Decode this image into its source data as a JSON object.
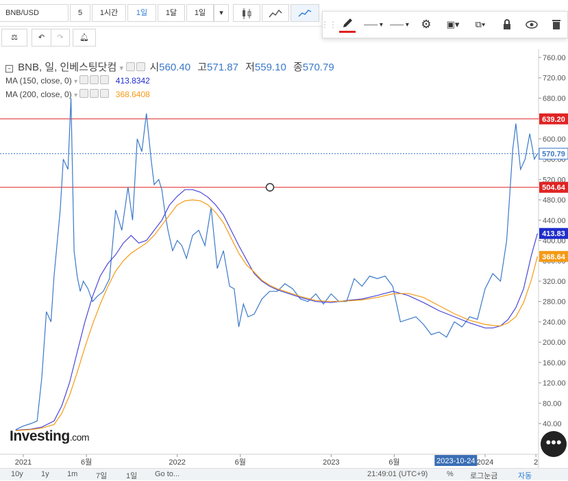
{
  "toolbar": {
    "symbol": "BNB/USD",
    "interval_value": "5",
    "btn_1h": "1시간",
    "btn_1d": "1일",
    "btn_1m": "1달",
    "btn_1d2": "1일"
  },
  "drawing_toolbar": {
    "pencil_color": "#e02020"
  },
  "legend": {
    "title": "BNB, 일, 인베스팅닷컴",
    "open_label": "시",
    "open_value": "560.40",
    "high_label": "고",
    "high_value": "571.87",
    "low_label": "저",
    "low_value": "559.10",
    "close_label": "종",
    "close_value": "570.79",
    "ma150_label": "MA (150, close, 0)",
    "ma150_value": "413.8342",
    "ma200_label": "MA (200, close, 0)",
    "ma200_value": "368.6408"
  },
  "watermark": {
    "brand": "Investing",
    "suffix": ".com"
  },
  "bottom": {
    "range_10y": "10y",
    "range_1y": "1y",
    "range_1m": "1m",
    "range_7d": "7일",
    "range_1d": "1일",
    "goto": "Go to...",
    "time": "21:49:01 (UTC+9)",
    "pct": "%",
    "log": "로그눈금",
    "auto": "자동"
  },
  "colors": {
    "price": "#3a78c9",
    "ma150": "#4a46d8",
    "ma200": "#f59a16",
    "hline": "#e02424",
    "ma150_tag": "#1f2dcc",
    "ma200_tag": "#f59a16",
    "price_tag": "#3a78c9"
  },
  "chart_data": {
    "type": "line",
    "title": "BNB, 일, 인베스팅닷컴",
    "ylim": [
      0,
      770
    ],
    "y_ticks": [
      40,
      80,
      120,
      160,
      200,
      240,
      280,
      320,
      360,
      400,
      440,
      480,
      520,
      560,
      600,
      640,
      680,
      720,
      760
    ],
    "x_tick_labels": [
      {
        "t": 2021.0,
        "label": "2021"
      },
      {
        "t": 2021.41,
        "label": "6월"
      },
      {
        "t": 2022.0,
        "label": "2022"
      },
      {
        "t": 2022.41,
        "label": "6월"
      },
      {
        "t": 2023.0,
        "label": "2023"
      },
      {
        "t": 2023.41,
        "label": "6월"
      },
      {
        "t": 2024.0,
        "label": "2024"
      },
      {
        "t": 2024.33,
        "label": "2"
      }
    ],
    "crosshair_x_label": "2023-10-24",
    "horizontal_lines": [
      639.2,
      504.64
    ],
    "price_tags": {
      "close": 570.79,
      "ma150": 413.83,
      "ma200": 368.64,
      "hline_top": 639.2,
      "hline_bottom": 504.64
    },
    "series": [
      {
        "name": "BNB",
        "x": [
          2020.95,
          2021.0,
          2021.05,
          2021.09,
          2021.12,
          2021.15,
          2021.18,
          2021.2,
          2021.24,
          2021.26,
          2021.29,
          2021.31,
          2021.33,
          2021.35,
          2021.37,
          2021.39,
          2021.42,
          2021.45,
          2021.48,
          2021.52,
          2021.56,
          2021.6,
          2021.64,
          2021.68,
          2021.71,
          2021.74,
          2021.77,
          2021.8,
          2021.83,
          2021.85,
          2021.88,
          2021.9,
          2021.92,
          2021.94,
          2021.97,
          2022.0,
          2022.03,
          2022.06,
          2022.1,
          2022.14,
          2022.18,
          2022.22,
          2022.26,
          2022.3,
          2022.34,
          2022.37,
          2022.4,
          2022.43,
          2022.46,
          2022.5,
          2022.55,
          2022.6,
          2022.65,
          2022.7,
          2022.75,
          2022.8,
          2022.85,
          2022.9,
          2022.95,
          2023.0,
          2023.05,
          2023.1,
          2023.15,
          2023.2,
          2023.25,
          2023.3,
          2023.35,
          2023.4,
          2023.45,
          2023.5,
          2023.55,
          2023.6,
          2023.65,
          2023.7,
          2023.75,
          2023.8,
          2023.85,
          2023.9,
          2023.95,
          2024.0,
          2024.05,
          2024.1,
          2024.14,
          2024.18,
          2024.2,
          2024.23,
          2024.26,
          2024.29,
          2024.32,
          2024.34
        ],
        "y": [
          28,
          35,
          40,
          45,
          130,
          260,
          240,
          330,
          460,
          560,
          540,
          680,
          380,
          330,
          300,
          320,
          305,
          280,
          290,
          300,
          325,
          460,
          420,
          505,
          440,
          600,
          575,
          650,
          560,
          510,
          520,
          500,
          455,
          420,
          380,
          400,
          390,
          365,
          410,
          420,
          390,
          465,
          345,
          380,
          310,
          305,
          230,
          275,
          250,
          255,
          285,
          300,
          300,
          315,
          305,
          285,
          280,
          295,
          275,
          295,
          280,
          280,
          325,
          310,
          330,
          325,
          330,
          310,
          240,
          245,
          250,
          235,
          215,
          220,
          210,
          240,
          230,
          250,
          245,
          305,
          335,
          320,
          400,
          580,
          630,
          540,
          560,
          610,
          560,
          570.79
        ]
      },
      {
        "name": "MA (150, close, 0)",
        "x": [
          2020.95,
          2021.05,
          2021.12,
          2021.2,
          2021.25,
          2021.3,
          2021.35,
          2021.4,
          2021.45,
          2021.5,
          2021.55,
          2021.6,
          2021.65,
          2021.7,
          2021.75,
          2021.8,
          2021.85,
          2021.9,
          2021.95,
          2022.0,
          2022.05,
          2022.1,
          2022.15,
          2022.2,
          2022.25,
          2022.3,
          2022.35,
          2022.4,
          2022.45,
          2022.5,
          2022.55,
          2022.6,
          2022.65,
          2022.7,
          2022.8,
          2022.9,
          2023.0,
          2023.1,
          2023.2,
          2023.3,
          2023.4,
          2023.5,
          2023.6,
          2023.7,
          2023.8,
          2023.9,
          2024.0,
          2024.05,
          2024.1,
          2024.15,
          2024.2,
          2024.25,
          2024.3,
          2024.34
        ],
        "y": [
          27,
          29,
          33,
          45,
          75,
          120,
          180,
          240,
          290,
          330,
          355,
          372,
          395,
          410,
          395,
          400,
          420,
          440,
          470,
          487,
          500,
          500,
          495,
          485,
          470,
          450,
          420,
          390,
          362,
          335,
          320,
          310,
          303,
          298,
          288,
          280,
          278,
          282,
          285,
          292,
          300,
          292,
          278,
          262,
          250,
          238,
          228,
          228,
          232,
          245,
          268,
          305,
          370,
          413.83
        ]
      },
      {
        "name": "MA (200, close, 0)",
        "x": [
          2020.95,
          2021.05,
          2021.12,
          2021.2,
          2021.25,
          2021.3,
          2021.35,
          2021.4,
          2021.45,
          2021.5,
          2021.55,
          2021.6,
          2021.65,
          2021.7,
          2021.75,
          2021.8,
          2021.85,
          2021.9,
          2021.95,
          2022.0,
          2022.05,
          2022.1,
          2022.15,
          2022.2,
          2022.25,
          2022.3,
          2022.35,
          2022.4,
          2022.45,
          2022.5,
          2022.55,
          2022.6,
          2022.65,
          2022.7,
          2022.8,
          2022.9,
          2023.0,
          2023.1,
          2023.2,
          2023.3,
          2023.4,
          2023.5,
          2023.6,
          2023.7,
          2023.8,
          2023.9,
          2024.0,
          2024.05,
          2024.1,
          2024.15,
          2024.2,
          2024.25,
          2024.3,
          2024.34
        ],
        "y": [
          26,
          28,
          31,
          38,
          60,
          95,
          140,
          190,
          235,
          275,
          310,
          340,
          360,
          375,
          385,
          395,
          410,
          430,
          450,
          470,
          478,
          480,
          478,
          470,
          455,
          435,
          405,
          375,
          352,
          338,
          322,
          312,
          305,
          300,
          290,
          282,
          280,
          281,
          283,
          288,
          295,
          296,
          288,
          272,
          256,
          243,
          235,
          233,
          232,
          238,
          250,
          278,
          322,
          368.64
        ]
      }
    ]
  }
}
